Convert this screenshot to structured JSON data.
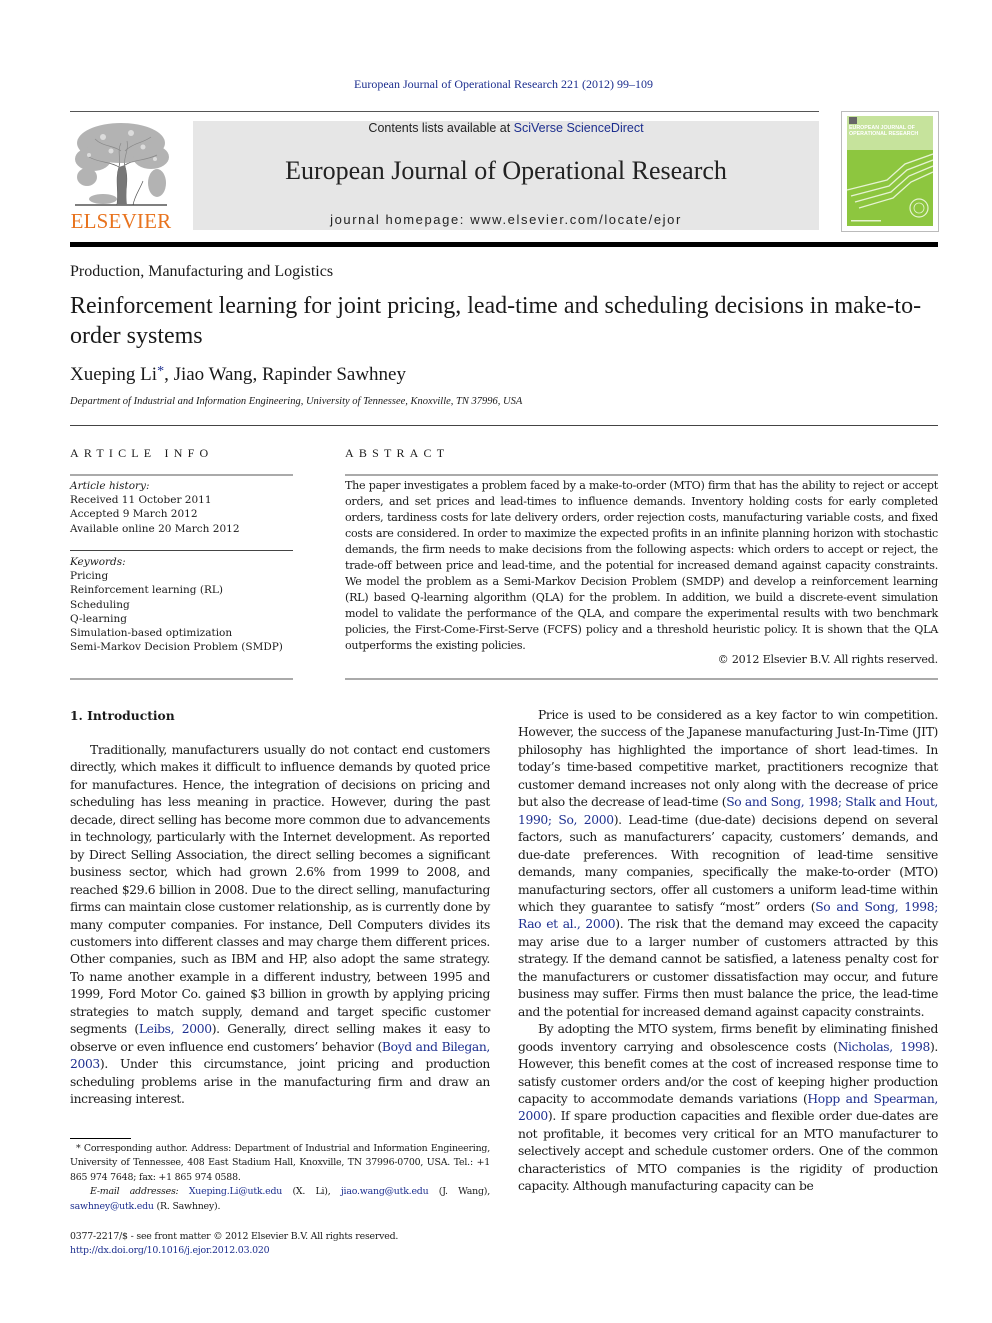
{
  "header": {
    "running_head": "European Journal of Operational Research 221 (2012) 99–109",
    "publisher_logo_text": "ELSEVIER",
    "contents_prefix": "Contents lists available at ",
    "contents_link": "SciVerse ScienceDirect",
    "journal_title": "European Journal of Operational Research",
    "homepage_prefix": "journal homepage: ",
    "homepage_url": "www.elsevier.com/locate/ejor",
    "cover_title_line1": "EUROPEAN JOURNAL OF",
    "cover_title_line2": "OPERATIONAL RESEARCH",
    "brand_color": "#e8731e",
    "link_color": "#1d2f8f",
    "cover_color": "#8dc63f"
  },
  "article": {
    "section": "Production, Manufacturing and Logistics",
    "title": "Reinforcement learning for joint pricing, lead-time and scheduling decisions in make-to-order systems",
    "authors": [
      {
        "name": "Xueping Li",
        "mark": "*"
      },
      {
        "name": "Jiao Wang",
        "mark": ""
      },
      {
        "name": "Rapinder Sawhney",
        "mark": ""
      }
    ],
    "author_separator": ", ",
    "affiliation": "Department of Industrial and Information Engineering, University of Tennessee, Knoxville, TN 37996, USA"
  },
  "article_info": {
    "heading": "ARTICLE INFO",
    "history_label": "Article history:",
    "history": [
      "Received 11 October 2011",
      "Accepted 9 March 2012",
      "Available online 20 March 2012"
    ],
    "keywords_label": "Keywords:",
    "keywords": [
      "Pricing",
      "Reinforcement learning (RL)",
      "Scheduling",
      "Q-learning",
      "Simulation-based optimization",
      "Semi-Markov Decision Problem (SMDP)"
    ]
  },
  "abstract": {
    "heading": "ABSTRACT",
    "text": "The paper investigates a problem faced by a make-to-order (MTO) firm that has the ability to reject or accept orders, and set prices and lead-times to influence demands. Inventory holding costs for early completed orders, tardiness costs for late delivery orders, order rejection costs, manufacturing variable costs, and fixed costs are considered. In order to maximize the expected profits in an infinite planning horizon with stochastic demands, the firm needs to make decisions from the following aspects: which orders to accept or reject, the trade-off between price and lead-time, and the potential for increased demand against capacity constraints. We model the problem as a Semi-Markov Decision Problem (SMDP) and develop a reinforcement learning (RL) based Q-learning algorithm (QLA) for the problem. In addition, we build a discrete-event simulation model to validate the performance of the QLA, and compare the experimental results with two benchmark policies, the First-Come-First-Serve (FCFS) policy and a threshold heuristic policy. It is shown that the QLA outperforms the existing policies.",
    "copyright": "© 2012 Elsevier B.V. All rights reserved."
  },
  "body": {
    "intro_heading": "1. Introduction",
    "left_paragraph": [
      {
        "t": "Traditionally, manufacturers usually do not contact end customers directly, which makes it difficult to influence demands by quoted price for manufactures. Hence, the integration of decisions on pricing and scheduling has less meaning in practice. However, during the past decade, direct selling has become more common due to advancements in technology, particularly with the Internet development. As reported by Direct Selling Association, the direct selling becomes a significant business sector, which had grown 2.6% from 1999 to 2008, and reached $29.6 billion in 2008. Due to the direct selling, manufacturing firms can maintain close customer relationship, as is currently done by many computer companies. For instance, Dell Computers divides its customers into different classes and may charge them different prices. Other companies, such as IBM and HP, also adopt the same strategy. To name another example in a different industry, between 1995 and 1999, Ford Motor Co. gained $3 billion in growth by applying pricing strategies to match supply, demand and target specific customer segments (",
        "link": false
      },
      {
        "t": "Leibs, 2000",
        "link": true
      },
      {
        "t": "). Generally, direct selling makes it easy to observe or even influence end customers’ behavior (",
        "link": false
      },
      {
        "t": "Boyd and Bilegan, 2003",
        "link": true
      },
      {
        "t": "). Under this circumstance, joint pricing and production scheduling problems arise in the manufacturing firm and draw an increasing interest.",
        "link": false
      }
    ],
    "right_paragraph_1": [
      {
        "t": "Price is used to be considered as a key factor to win competition. However, the success of the Japanese manufacturing Just-In-Time (JIT) philosophy has highlighted the importance of short lead-times. In today’s time-based competitive market, practitioners recognize that customer demand increases not only along with the decrease of price but also the decrease of lead-time (",
        "link": false
      },
      {
        "t": "So and Song, 1998; Stalk and Hout, 1990; So, 2000",
        "link": true
      },
      {
        "t": "). Lead-time (due-date) decisions depend on several factors, such as manufacturers’ capacity, customers’ demands, and due-date preferences. With recognition of lead-time sensitive demands, many companies, specifically the make-to-order (MTO) manufacturing sectors, offer all customers a uniform lead-time within which they guarantee to satisfy “most” orders (",
        "link": false
      },
      {
        "t": "So and Song, 1998; Rao et al., 2000",
        "link": true
      },
      {
        "t": "). The risk that the demand may exceed the capacity may arise due to a larger number of customers attracted by this strategy. If the demand cannot be satisfied, a lateness penalty cost for the manufacturers or customer dissatisfaction may occur, and future business may suffer. Firms then must balance the price, the lead-time and the potential for increased demand against capacity constraints.",
        "link": false
      }
    ],
    "right_paragraph_2": [
      {
        "t": "By adopting the MTO system, firms benefit by eliminating finished goods inventory carrying and obsolescence costs (",
        "link": false
      },
      {
        "t": "Nicholas, 1998",
        "link": true
      },
      {
        "t": "). However, this benefit comes at the cost of increased response time to satisfy customer orders and/or the cost of keeping higher production capacity to accommodate demands variations (",
        "link": false
      },
      {
        "t": "Hopp and Spearman, 2000",
        "link": true
      },
      {
        "t": "). If spare production capacities and flexible order due-dates are not profitable, it becomes very critical for an MTO manufacturer to selectively accept and schedule customer orders. One of the common characteristics of MTO companies is the rigidity of production capacity. Although manufacturing capacity can be",
        "link": false
      }
    ]
  },
  "footnote": {
    "corresponding": "* Corresponding author. Address: Department of Industrial and Information Engineering, University of Tennessee, 408 East Stadium Hall, Knoxville, TN 37996-0700, USA. Tel.: +1 865 974 7648; fax: +1 865 974 0588.",
    "email_label": "E-mail addresses:",
    "emails": [
      {
        "address": "Xueping.Li@utk.edu",
        "who": " (X. Li), "
      },
      {
        "address": "jiao.wang@utk.edu",
        "who": " (J. Wang), "
      },
      {
        "address": "sawhney@utk.edu",
        "who": " (R. Sawhney)."
      }
    ],
    "front_matter": "0377-2217/$ - see front matter © 2012 Elsevier B.V. All rights reserved.",
    "doi": "http://dx.doi.org/10.1016/j.ejor.2012.03.020"
  }
}
